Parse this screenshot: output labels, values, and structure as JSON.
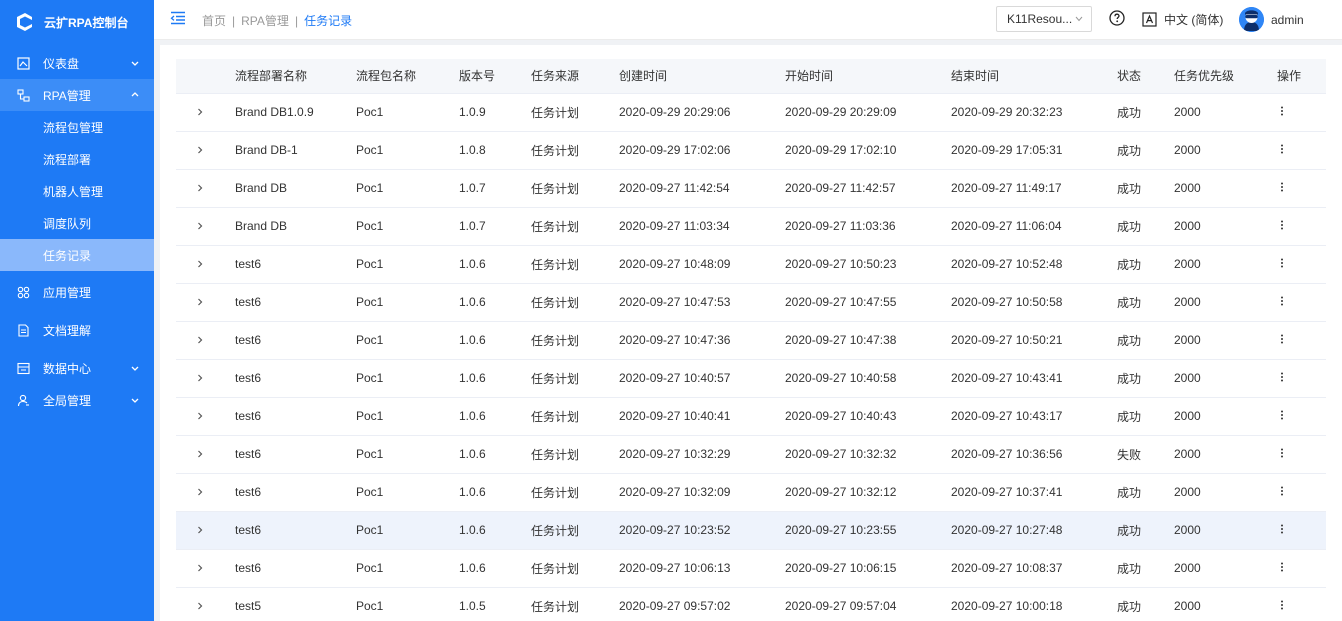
{
  "app": {
    "title": "云扩RPA控制台"
  },
  "sidebar": {
    "items": [
      {
        "label": "仪表盘",
        "icon": "dashboard-icon",
        "has_arrow": true,
        "arrow": "down"
      },
      {
        "label": "RPA管理",
        "icon": "rpa-icon",
        "has_arrow": true,
        "arrow": "up",
        "open": true,
        "children": [
          {
            "label": "流程包管理"
          },
          {
            "label": "流程部署"
          },
          {
            "label": "机器人管理"
          },
          {
            "label": "调度队列"
          },
          {
            "label": "任务记录",
            "active": true
          }
        ]
      },
      {
        "label": "应用管理",
        "icon": "apps-icon",
        "has_arrow": false
      },
      {
        "label": "文档理解",
        "icon": "document-icon",
        "has_arrow": false
      },
      {
        "label": "数据中心",
        "icon": "data-center-icon",
        "has_arrow": true,
        "arrow": "down"
      },
      {
        "label": "全局管理",
        "icon": "user-settings-icon",
        "has_arrow": true,
        "arrow": "down"
      }
    ]
  },
  "header": {
    "breadcrumb": [
      "首页",
      "RPA管理",
      "任务记录"
    ],
    "resource_select": "K11Resou...",
    "language": "中文 (简体)",
    "username": "admin"
  },
  "table": {
    "columns": [
      "流程部署名称",
      "流程包名称",
      "版本号",
      "任务来源",
      "创建时间",
      "开始时间",
      "结束时间",
      "状态",
      "任务优先级",
      "操作"
    ],
    "rows": [
      {
        "name": "Brand DB1.0.9",
        "pkg": "Poc1",
        "ver": "1.0.9",
        "src": "任务计划",
        "ct": "2020-09-29 20:29:06",
        "st": "2020-09-29 20:29:09",
        "et": "2020-09-29 20:32:23",
        "status": "成功",
        "pri": "2000"
      },
      {
        "name": "Brand DB-1",
        "pkg": "Poc1",
        "ver": "1.0.8",
        "src": "任务计划",
        "ct": "2020-09-29 17:02:06",
        "st": "2020-09-29 17:02:10",
        "et": "2020-09-29 17:05:31",
        "status": "成功",
        "pri": "2000"
      },
      {
        "name": "Brand DB",
        "pkg": "Poc1",
        "ver": "1.0.7",
        "src": "任务计划",
        "ct": "2020-09-27 11:42:54",
        "st": "2020-09-27 11:42:57",
        "et": "2020-09-27 11:49:17",
        "status": "成功",
        "pri": "2000"
      },
      {
        "name": "Brand DB",
        "pkg": "Poc1",
        "ver": "1.0.7",
        "src": "任务计划",
        "ct": "2020-09-27 11:03:34",
        "st": "2020-09-27 11:03:36",
        "et": "2020-09-27 11:06:04",
        "status": "成功",
        "pri": "2000"
      },
      {
        "name": "test6",
        "pkg": "Poc1",
        "ver": "1.0.6",
        "src": "任务计划",
        "ct": "2020-09-27 10:48:09",
        "st": "2020-09-27 10:50:23",
        "et": "2020-09-27 10:52:48",
        "status": "成功",
        "pri": "2000"
      },
      {
        "name": "test6",
        "pkg": "Poc1",
        "ver": "1.0.6",
        "src": "任务计划",
        "ct": "2020-09-27 10:47:53",
        "st": "2020-09-27 10:47:55",
        "et": "2020-09-27 10:50:58",
        "status": "成功",
        "pri": "2000"
      },
      {
        "name": "test6",
        "pkg": "Poc1",
        "ver": "1.0.6",
        "src": "任务计划",
        "ct": "2020-09-27 10:47:36",
        "st": "2020-09-27 10:47:38",
        "et": "2020-09-27 10:50:21",
        "status": "成功",
        "pri": "2000"
      },
      {
        "name": "test6",
        "pkg": "Poc1",
        "ver": "1.0.6",
        "src": "任务计划",
        "ct": "2020-09-27 10:40:57",
        "st": "2020-09-27 10:40:58",
        "et": "2020-09-27 10:43:41",
        "status": "成功",
        "pri": "2000"
      },
      {
        "name": "test6",
        "pkg": "Poc1",
        "ver": "1.0.6",
        "src": "任务计划",
        "ct": "2020-09-27 10:40:41",
        "st": "2020-09-27 10:40:43",
        "et": "2020-09-27 10:43:17",
        "status": "成功",
        "pri": "2000"
      },
      {
        "name": "test6",
        "pkg": "Poc1",
        "ver": "1.0.6",
        "src": "任务计划",
        "ct": "2020-09-27 10:32:29",
        "st": "2020-09-27 10:32:32",
        "et": "2020-09-27 10:36:56",
        "status": "失败",
        "pri": "2000"
      },
      {
        "name": "test6",
        "pkg": "Poc1",
        "ver": "1.0.6",
        "src": "任务计划",
        "ct": "2020-09-27 10:32:09",
        "st": "2020-09-27 10:32:12",
        "et": "2020-09-27 10:37:41",
        "status": "成功",
        "pri": "2000"
      },
      {
        "name": "test6",
        "pkg": "Poc1",
        "ver": "1.0.6",
        "src": "任务计划",
        "ct": "2020-09-27 10:23:52",
        "st": "2020-09-27 10:23:55",
        "et": "2020-09-27 10:27:48",
        "status": "成功",
        "pri": "2000",
        "highlighted": true
      },
      {
        "name": "test6",
        "pkg": "Poc1",
        "ver": "1.0.6",
        "src": "任务计划",
        "ct": "2020-09-27 10:06:13",
        "st": "2020-09-27 10:06:15",
        "et": "2020-09-27 10:08:37",
        "status": "成功",
        "pri": "2000"
      },
      {
        "name": "test5",
        "pkg": "Poc1",
        "ver": "1.0.5",
        "src": "任务计划",
        "ct": "2020-09-27 09:57:02",
        "st": "2020-09-27 09:57:04",
        "et": "2020-09-27 10:00:18",
        "status": "成功",
        "pri": "2000"
      }
    ]
  },
  "colors": {
    "sidebar_bg": "#1e7af5",
    "accent": "#1e7af5",
    "active_sub_bg": "#8ab8fb",
    "highlight_row": "#eef3fc"
  }
}
